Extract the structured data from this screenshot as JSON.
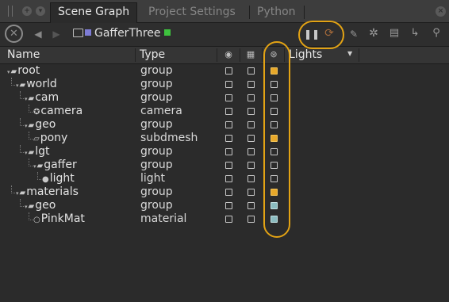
{
  "tabs": [
    {
      "label": "Scene Graph",
      "active": true
    },
    {
      "label": "Project Settings",
      "active": false
    },
    {
      "label": "Python",
      "active": false
    }
  ],
  "toolbar": {
    "node_name": "GafferThree",
    "icons": [
      "stop-icon",
      "back-arrow-icon",
      "forward-arrow-icon",
      "node-folder-icon",
      "pause-icon",
      "refresh-icon",
      "pencil-icon",
      "gear-icon",
      "clapboard-icon",
      "link-icon",
      "search-icon"
    ]
  },
  "columns": {
    "name": "Name",
    "type": "Type",
    "lights": "Lights"
  },
  "rows": [
    {
      "name": "root",
      "type": "group",
      "depth": 0,
      "icon": "group-icon",
      "c1": "off",
      "c2": "off",
      "c3": "orange"
    },
    {
      "name": "world",
      "type": "group",
      "depth": 1,
      "icon": "group-icon",
      "c1": "off",
      "c2": "off",
      "c3": "off"
    },
    {
      "name": "cam",
      "type": "group",
      "depth": 2,
      "icon": "group-icon",
      "c1": "off",
      "c2": "off",
      "c3": "off"
    },
    {
      "name": "camera",
      "type": "camera",
      "depth": 3,
      "icon": "camera-icon",
      "c1": "off",
      "c2": "off",
      "c3": "off"
    },
    {
      "name": "geo",
      "type": "group",
      "depth": 2,
      "icon": "group-icon",
      "c1": "off",
      "c2": "off",
      "c3": "off"
    },
    {
      "name": "pony",
      "type": "subdmesh",
      "depth": 3,
      "icon": "mesh-icon",
      "c1": "off",
      "c2": "off",
      "c3": "orange"
    },
    {
      "name": "lgt",
      "type": "group",
      "depth": 2,
      "icon": "group-icon",
      "c1": "off",
      "c2": "off",
      "c3": "off"
    },
    {
      "name": "gaffer",
      "type": "group",
      "depth": 3,
      "icon": "group-icon",
      "c1": "off",
      "c2": "off",
      "c3": "off"
    },
    {
      "name": "light",
      "type": "light",
      "depth": 4,
      "icon": "light-icon",
      "c1": "off",
      "c2": "off",
      "c3": "off"
    },
    {
      "name": "materials",
      "type": "group",
      "depth": 1,
      "icon": "group-icon",
      "c1": "off",
      "c2": "off",
      "c3": "orange"
    },
    {
      "name": "geo",
      "type": "group",
      "depth": 2,
      "icon": "group-icon",
      "c1": "off",
      "c2": "off",
      "c3": "teal"
    },
    {
      "name": "PinkMat",
      "type": "material",
      "depth": 3,
      "icon": "material-icon",
      "c1": "off",
      "c2": "off",
      "c3": "teal"
    }
  ],
  "colors": {
    "accent_highlight": "#e3a314",
    "checkbox_orange": "#e7a82a",
    "checkbox_teal": "#8bbcc0",
    "node_color": "#7e7cd6",
    "node_status": "#3ec23e"
  }
}
